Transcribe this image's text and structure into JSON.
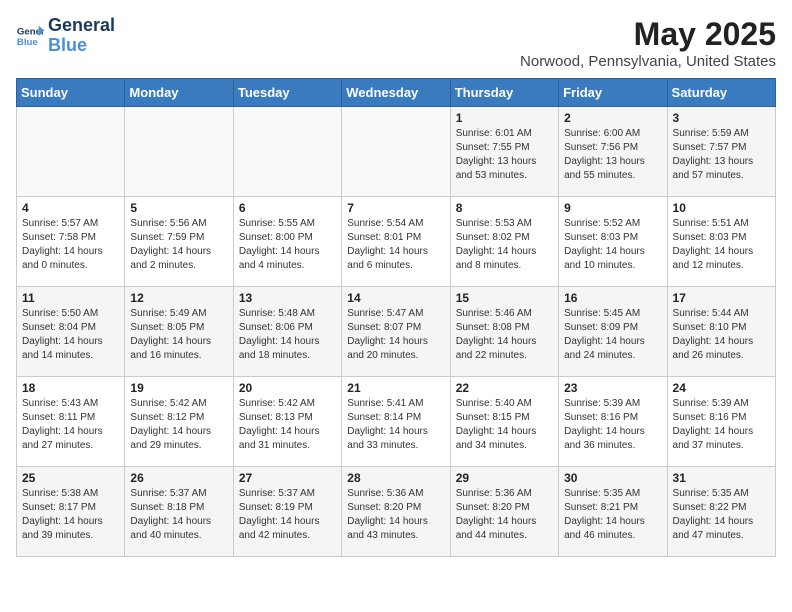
{
  "header": {
    "logo_line1": "General",
    "logo_line2": "Blue",
    "month": "May 2025",
    "location": "Norwood, Pennsylvania, United States"
  },
  "weekdays": [
    "Sunday",
    "Monday",
    "Tuesday",
    "Wednesday",
    "Thursday",
    "Friday",
    "Saturday"
  ],
  "weeks": [
    [
      {
        "day": "",
        "info": ""
      },
      {
        "day": "",
        "info": ""
      },
      {
        "day": "",
        "info": ""
      },
      {
        "day": "",
        "info": ""
      },
      {
        "day": "1",
        "info": "Sunrise: 6:01 AM\nSunset: 7:55 PM\nDaylight: 13 hours\nand 53 minutes."
      },
      {
        "day": "2",
        "info": "Sunrise: 6:00 AM\nSunset: 7:56 PM\nDaylight: 13 hours\nand 55 minutes."
      },
      {
        "day": "3",
        "info": "Sunrise: 5:59 AM\nSunset: 7:57 PM\nDaylight: 13 hours\nand 57 minutes."
      }
    ],
    [
      {
        "day": "4",
        "info": "Sunrise: 5:57 AM\nSunset: 7:58 PM\nDaylight: 14 hours\nand 0 minutes."
      },
      {
        "day": "5",
        "info": "Sunrise: 5:56 AM\nSunset: 7:59 PM\nDaylight: 14 hours\nand 2 minutes."
      },
      {
        "day": "6",
        "info": "Sunrise: 5:55 AM\nSunset: 8:00 PM\nDaylight: 14 hours\nand 4 minutes."
      },
      {
        "day": "7",
        "info": "Sunrise: 5:54 AM\nSunset: 8:01 PM\nDaylight: 14 hours\nand 6 minutes."
      },
      {
        "day": "8",
        "info": "Sunrise: 5:53 AM\nSunset: 8:02 PM\nDaylight: 14 hours\nand 8 minutes."
      },
      {
        "day": "9",
        "info": "Sunrise: 5:52 AM\nSunset: 8:03 PM\nDaylight: 14 hours\nand 10 minutes."
      },
      {
        "day": "10",
        "info": "Sunrise: 5:51 AM\nSunset: 8:03 PM\nDaylight: 14 hours\nand 12 minutes."
      }
    ],
    [
      {
        "day": "11",
        "info": "Sunrise: 5:50 AM\nSunset: 8:04 PM\nDaylight: 14 hours\nand 14 minutes."
      },
      {
        "day": "12",
        "info": "Sunrise: 5:49 AM\nSunset: 8:05 PM\nDaylight: 14 hours\nand 16 minutes."
      },
      {
        "day": "13",
        "info": "Sunrise: 5:48 AM\nSunset: 8:06 PM\nDaylight: 14 hours\nand 18 minutes."
      },
      {
        "day": "14",
        "info": "Sunrise: 5:47 AM\nSunset: 8:07 PM\nDaylight: 14 hours\nand 20 minutes."
      },
      {
        "day": "15",
        "info": "Sunrise: 5:46 AM\nSunset: 8:08 PM\nDaylight: 14 hours\nand 22 minutes."
      },
      {
        "day": "16",
        "info": "Sunrise: 5:45 AM\nSunset: 8:09 PM\nDaylight: 14 hours\nand 24 minutes."
      },
      {
        "day": "17",
        "info": "Sunrise: 5:44 AM\nSunset: 8:10 PM\nDaylight: 14 hours\nand 26 minutes."
      }
    ],
    [
      {
        "day": "18",
        "info": "Sunrise: 5:43 AM\nSunset: 8:11 PM\nDaylight: 14 hours\nand 27 minutes."
      },
      {
        "day": "19",
        "info": "Sunrise: 5:42 AM\nSunset: 8:12 PM\nDaylight: 14 hours\nand 29 minutes."
      },
      {
        "day": "20",
        "info": "Sunrise: 5:42 AM\nSunset: 8:13 PM\nDaylight: 14 hours\nand 31 minutes."
      },
      {
        "day": "21",
        "info": "Sunrise: 5:41 AM\nSunset: 8:14 PM\nDaylight: 14 hours\nand 33 minutes."
      },
      {
        "day": "22",
        "info": "Sunrise: 5:40 AM\nSunset: 8:15 PM\nDaylight: 14 hours\nand 34 minutes."
      },
      {
        "day": "23",
        "info": "Sunrise: 5:39 AM\nSunset: 8:16 PM\nDaylight: 14 hours\nand 36 minutes."
      },
      {
        "day": "24",
        "info": "Sunrise: 5:39 AM\nSunset: 8:16 PM\nDaylight: 14 hours\nand 37 minutes."
      }
    ],
    [
      {
        "day": "25",
        "info": "Sunrise: 5:38 AM\nSunset: 8:17 PM\nDaylight: 14 hours\nand 39 minutes."
      },
      {
        "day": "26",
        "info": "Sunrise: 5:37 AM\nSunset: 8:18 PM\nDaylight: 14 hours\nand 40 minutes."
      },
      {
        "day": "27",
        "info": "Sunrise: 5:37 AM\nSunset: 8:19 PM\nDaylight: 14 hours\nand 42 minutes."
      },
      {
        "day": "28",
        "info": "Sunrise: 5:36 AM\nSunset: 8:20 PM\nDaylight: 14 hours\nand 43 minutes."
      },
      {
        "day": "29",
        "info": "Sunrise: 5:36 AM\nSunset: 8:20 PM\nDaylight: 14 hours\nand 44 minutes."
      },
      {
        "day": "30",
        "info": "Sunrise: 5:35 AM\nSunset: 8:21 PM\nDaylight: 14 hours\nand 46 minutes."
      },
      {
        "day": "31",
        "info": "Sunrise: 5:35 AM\nSunset: 8:22 PM\nDaylight: 14 hours\nand 47 minutes."
      }
    ]
  ]
}
